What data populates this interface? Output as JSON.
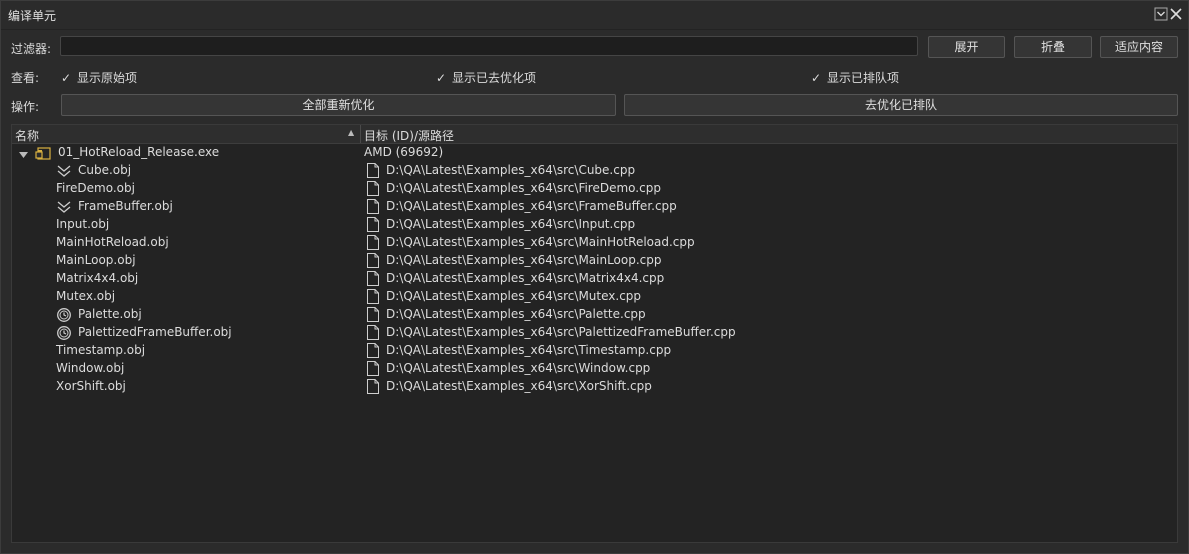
{
  "window": {
    "title": "编译单元"
  },
  "filter": {
    "label": "过滤器:",
    "value": "",
    "placeholder": ""
  },
  "buttons": {
    "expand": "展开",
    "collapse": "折叠",
    "fit": "适应内容"
  },
  "view": {
    "label": "查看:",
    "options": [
      {
        "label": "显示原始项",
        "checked": true
      },
      {
        "label": "显示已去优化项",
        "checked": true
      },
      {
        "label": "显示已排队项",
        "checked": true
      }
    ]
  },
  "actions": {
    "label": "操作:",
    "reoptimize_all": "全部重新优化",
    "deoptimize_queued": "去优化已排队"
  },
  "table": {
    "columns": [
      "名称",
      "目标 (ID)/源路径"
    ],
    "root": {
      "name": "01_HotReload_Release.exe",
      "target": "AMD (69692)",
      "expanded": true,
      "icon": "executable-icon"
    },
    "rows": [
      {
        "name": "Cube.obj",
        "path": "D:\\QA\\Latest\\Examples_x64\\src\\Cube.cpp",
        "icon": "deoptimized-icon"
      },
      {
        "name": "FireDemo.obj",
        "path": "D:\\QA\\Latest\\Examples_x64\\src\\FireDemo.cpp",
        "icon": ""
      },
      {
        "name": "FrameBuffer.obj",
        "path": "D:\\QA\\Latest\\Examples_x64\\src\\FrameBuffer.cpp",
        "icon": "deoptimized-icon"
      },
      {
        "name": "Input.obj",
        "path": "D:\\QA\\Latest\\Examples_x64\\src\\Input.cpp",
        "icon": ""
      },
      {
        "name": "MainHotReload.obj",
        "path": "D:\\QA\\Latest\\Examples_x64\\src\\MainHotReload.cpp",
        "icon": ""
      },
      {
        "name": "MainLoop.obj",
        "path": "D:\\QA\\Latest\\Examples_x64\\src\\MainLoop.cpp",
        "icon": ""
      },
      {
        "name": "Matrix4x4.obj",
        "path": "D:\\QA\\Latest\\Examples_x64\\src\\Matrix4x4.cpp",
        "icon": ""
      },
      {
        "name": "Mutex.obj",
        "path": "D:\\QA\\Latest\\Examples_x64\\src\\Mutex.cpp",
        "icon": ""
      },
      {
        "name": "Palette.obj",
        "path": "D:\\QA\\Latest\\Examples_x64\\src\\Palette.cpp",
        "icon": "queued-clock-icon"
      },
      {
        "name": "PalettizedFrameBuffer.obj",
        "path": "D:\\QA\\Latest\\Examples_x64\\src\\PalettizedFrameBuffer.cpp",
        "icon": "queued-clock-icon"
      },
      {
        "name": "Timestamp.obj",
        "path": "D:\\QA\\Latest\\Examples_x64\\src\\Timestamp.cpp",
        "icon": ""
      },
      {
        "name": "Window.obj",
        "path": "D:\\QA\\Latest\\Examples_x64\\src\\Window.cpp",
        "icon": ""
      },
      {
        "name": "XorShift.obj",
        "path": "D:\\QA\\Latest\\Examples_x64\\src\\XorShift.cpp",
        "icon": ""
      }
    ]
  }
}
